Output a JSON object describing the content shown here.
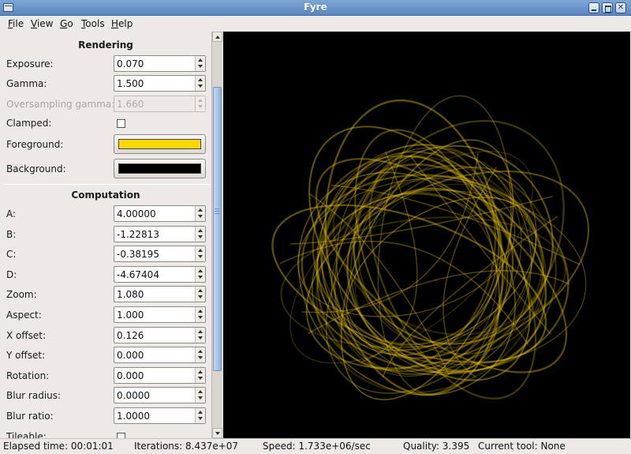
{
  "window": {
    "title": "Fyre"
  },
  "menubar": {
    "items": [
      "File",
      "View",
      "Go",
      "Tools",
      "Help"
    ]
  },
  "rendering": {
    "title": "Rendering",
    "exposure": {
      "label": "Exposure:",
      "value": "0.070"
    },
    "gamma": {
      "label": "Gamma:",
      "value": "1.500"
    },
    "oversampling_gamma": {
      "label": "Oversampling gamma:",
      "value": "1.660"
    },
    "clamped": {
      "label": "Clamped:",
      "checked": false
    },
    "foreground": {
      "label": "Foreground:",
      "color": "#ffd700"
    },
    "background": {
      "label": "Background:",
      "color": "#000000"
    }
  },
  "computation": {
    "title": "Computation",
    "fields": [
      {
        "label": "A:",
        "value": "4.00000"
      },
      {
        "label": "B:",
        "value": "-1.22813"
      },
      {
        "label": "C:",
        "value": "-0.38195"
      },
      {
        "label": "D:",
        "value": "-4.67404"
      },
      {
        "label": "Zoom:",
        "value": "1.080"
      },
      {
        "label": "Aspect:",
        "value": "1.000"
      },
      {
        "label": "X offset:",
        "value": "0.126"
      },
      {
        "label": "Y offset:",
        "value": "0.000"
      },
      {
        "label": "Rotation:",
        "value": "0.000"
      },
      {
        "label": "Blur radius:",
        "value": "0.0000"
      },
      {
        "label": "Blur ratio:",
        "value": "1.0000"
      }
    ],
    "tileable": {
      "label": "Tileable:",
      "checked": false
    }
  },
  "statusbar": {
    "elapsed": "Elapsed time: 00:01:01",
    "iterations": "Iterations: 8.437e+07",
    "speed": "Speed: 1.733e+06/sec",
    "quality": "Quality: 3.395",
    "tool": "Current tool: None"
  },
  "colors": {
    "attractor": "#e8c400",
    "canvas_bg": "#000000"
  }
}
